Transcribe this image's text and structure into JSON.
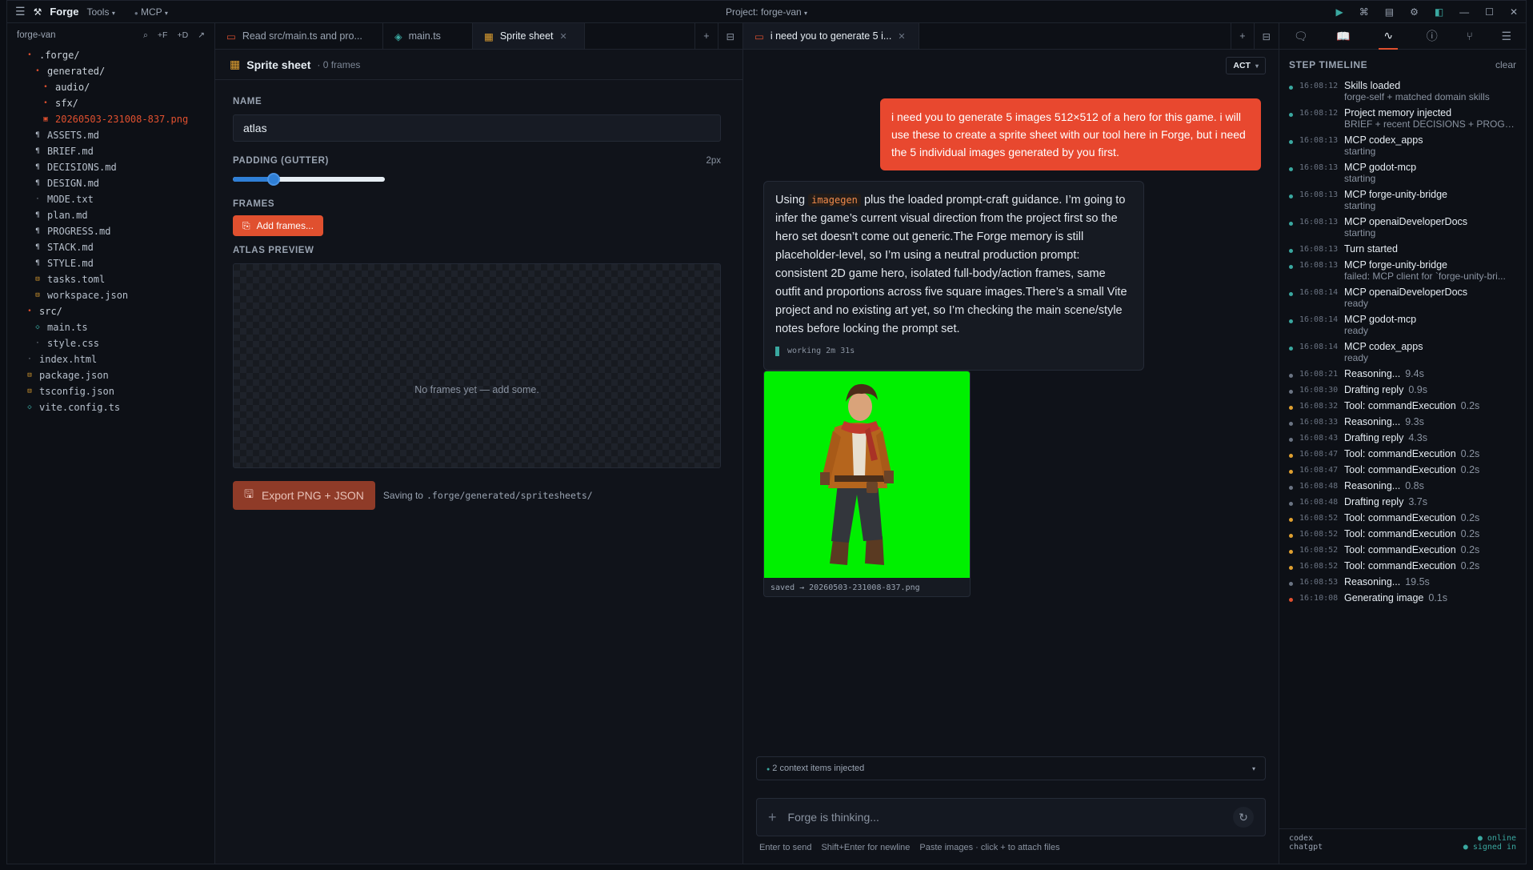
{
  "titlebar": {
    "brand": "Forge",
    "tools_label": "Tools",
    "mcp_label": "MCP",
    "project": "Project: forge-van"
  },
  "tree": {
    "root": "forge-van",
    "actions": [
      "+F",
      "+D"
    ],
    "items": [
      {
        "label": ".forge/",
        "icon": "chevron-icon",
        "indent": 1,
        "color": "#c9d1d9"
      },
      {
        "label": "generated/",
        "icon": "chevron-icon",
        "indent": 2,
        "color": "#c9d1d9"
      },
      {
        "label": "audio/",
        "icon": "chevron-icon",
        "indent": 3,
        "color": "#c9d1d9"
      },
      {
        "label": "sfx/",
        "icon": "chevron-icon",
        "indent": 3,
        "color": "#c9d1d9"
      },
      {
        "label": "20260503-231008-837.png",
        "icon": "image-file-icon",
        "indent": 3,
        "color": "#e0502f"
      },
      {
        "label": "ASSETS.md",
        "icon": "markdown-icon",
        "indent": 2,
        "color": "#b7c0cc"
      },
      {
        "label": "BRIEF.md",
        "icon": "markdown-icon",
        "indent": 2,
        "color": "#b7c0cc"
      },
      {
        "label": "DECISIONS.md",
        "icon": "markdown-icon",
        "indent": 2,
        "color": "#b7c0cc"
      },
      {
        "label": "DESIGN.md",
        "icon": "markdown-icon",
        "indent": 2,
        "color": "#b7c0cc"
      },
      {
        "label": "MODE.txt",
        "icon": "text-file-icon",
        "indent": 2,
        "color": "#b7c0cc"
      },
      {
        "label": "plan.md",
        "icon": "markdown-icon",
        "indent": 2,
        "color": "#b7c0cc"
      },
      {
        "label": "PROGRESS.md",
        "icon": "markdown-icon",
        "indent": 2,
        "color": "#b7c0cc"
      },
      {
        "label": "STACK.md",
        "icon": "markdown-icon",
        "indent": 2,
        "color": "#b7c0cc"
      },
      {
        "label": "STYLE.md",
        "icon": "markdown-icon",
        "indent": 2,
        "color": "#b7c0cc"
      },
      {
        "label": "tasks.toml",
        "icon": "config-file-icon",
        "indent": 2,
        "color": "#b7c0cc"
      },
      {
        "label": "workspace.json",
        "icon": "json-file-icon",
        "indent": 2,
        "color": "#b7c0cc"
      },
      {
        "label": "src/",
        "icon": "chevron-icon",
        "indent": 1,
        "color": "#c9d1d9"
      },
      {
        "label": "main.ts",
        "icon": "ts-file-icon",
        "indent": 2,
        "color": "#b7c0cc"
      },
      {
        "label": "style.css",
        "icon": "css-file-icon",
        "indent": 2,
        "color": "#b7c0cc"
      },
      {
        "label": "index.html",
        "icon": "html-file-icon",
        "indent": 1,
        "color": "#b7c0cc"
      },
      {
        "label": "package.json",
        "icon": "json-file-icon",
        "indent": 1,
        "color": "#b7c0cc"
      },
      {
        "label": "tsconfig.json",
        "icon": "json-file-icon",
        "indent": 1,
        "color": "#b7c0cc"
      },
      {
        "label": "vite.config.ts",
        "icon": "ts-file-icon",
        "indent": 1,
        "color": "#b7c0cc"
      }
    ]
  },
  "mid": {
    "tabs": [
      {
        "label": "Read src/main.ts and pro...",
        "icon": "chat-icon",
        "active": false
      },
      {
        "label": "main.ts",
        "icon": "ts-file-icon",
        "active": false
      },
      {
        "label": "Sprite sheet",
        "icon": "grid-icon",
        "active": true
      }
    ],
    "header_title": "Sprite sheet",
    "header_sub": "· 0 frames",
    "name_label": "NAME",
    "name_value": "atlas",
    "padding_label": "PADDING (GUTTER)",
    "padding_value_text": "2px",
    "padding_fraction": 0.27,
    "frames_label": "FRAMES",
    "add_frames": "Add frames...",
    "preview_label": "ATLAS PREVIEW",
    "preview_empty": "No frames yet — add some.",
    "export_label": "Export PNG + JSON",
    "saving_prefix": "Saving to",
    "saving_path": ".forge/generated/spritesheets/"
  },
  "chat": {
    "tab_label": "i need you to generate 5 i...",
    "mode": "ACT",
    "user_message": "i need you to generate 5 images 512×512 of a hero for this game. i will use these to create a sprite sheet with our tool here in Forge, but i need the 5 individual images generated by you first.",
    "ai_prefix": "Using",
    "ai_code": "imagegen",
    "ai_text": "plus the loaded prompt-craft guidance. I’m going to infer the game’s current visual direction from the project first so the hero set doesn’t come out generic.The Forge memory is still placeholder-level, so I’m using a neutral production prompt: consistent 2D game hero, isolated full-body/action frames, same outfit and proportions across five square images.There’s a small Vite project and no existing art yet, so I’m checking the main scene/style notes before locking the prompt set.",
    "working": "working 2m 31s",
    "image_caption": "saved → 20260503-231008-837.png",
    "context": "2 context items injected",
    "composer_placeholder": "Forge is thinking...",
    "hint_send": "Enter to send",
    "hint_newline": "Shift+Enter for newline",
    "hint_paste": "Paste images · click + to attach files"
  },
  "timeline": {
    "title": "STEP TIMELINE",
    "clear": "clear",
    "steps": [
      {
        "time": "16:08:12",
        "name": "Skills loaded",
        "sub": "forge-self + matched domain skills",
        "dur": "",
        "color": "#3aa8a0"
      },
      {
        "time": "16:08:12",
        "name": "Project memory injected",
        "sub": "BRIEF + recent DECISIONS + PROGR...",
        "dur": "",
        "color": "#3aa8a0"
      },
      {
        "time": "16:08:13",
        "name": "MCP codex_apps",
        "sub": "starting",
        "dur": "",
        "color": "#3aa8a0"
      },
      {
        "time": "16:08:13",
        "name": "MCP godot-mcp",
        "sub": "starting",
        "dur": "",
        "color": "#3aa8a0"
      },
      {
        "time": "16:08:13",
        "name": "MCP forge-unity-bridge",
        "sub": "starting",
        "dur": "",
        "color": "#3aa8a0"
      },
      {
        "time": "16:08:13",
        "name": "MCP openaiDeveloperDocs",
        "sub": "starting",
        "dur": "",
        "color": "#3aa8a0"
      },
      {
        "time": "16:08:13",
        "name": "Turn started",
        "sub": "",
        "dur": "",
        "color": "#3aa8a0"
      },
      {
        "time": "16:08:13",
        "name": "MCP forge-unity-bridge",
        "sub": "failed: MCP client for `forge-unity-bri...",
        "dur": "",
        "color": "#3aa8a0"
      },
      {
        "time": "16:08:14",
        "name": "MCP openaiDeveloperDocs",
        "sub": "ready",
        "dur": "",
        "color": "#3aa8a0"
      },
      {
        "time": "16:08:14",
        "name": "MCP godot-mcp",
        "sub": "ready",
        "dur": "",
        "color": "#3aa8a0"
      },
      {
        "time": "16:08:14",
        "name": "MCP codex_apps",
        "sub": "ready",
        "dur": "",
        "color": "#3aa8a0"
      },
      {
        "time": "16:08:21",
        "name": "Reasoning...",
        "sub": "",
        "dur": "9.4s",
        "color": "#6b7483"
      },
      {
        "time": "16:08:30",
        "name": "Drafting reply",
        "sub": "",
        "dur": "0.9s",
        "color": "#6b7483"
      },
      {
        "time": "16:08:32",
        "name": "Tool: commandExecution",
        "sub": "",
        "dur": "0.2s",
        "color": "#e0a030"
      },
      {
        "time": "16:08:33",
        "name": "Reasoning...",
        "sub": "",
        "dur": "9.3s",
        "color": "#6b7483"
      },
      {
        "time": "16:08:43",
        "name": "Drafting reply",
        "sub": "",
        "dur": "4.3s",
        "color": "#6b7483"
      },
      {
        "time": "16:08:47",
        "name": "Tool: commandExecution",
        "sub": "",
        "dur": "0.2s",
        "color": "#e0a030"
      },
      {
        "time": "16:08:47",
        "name": "Tool: commandExecution",
        "sub": "",
        "dur": "0.2s",
        "color": "#e0a030"
      },
      {
        "time": "16:08:48",
        "name": "Reasoning...",
        "sub": "",
        "dur": "0.8s",
        "color": "#6b7483"
      },
      {
        "time": "16:08:48",
        "name": "Drafting reply",
        "sub": "",
        "dur": "3.7s",
        "color": "#6b7483"
      },
      {
        "time": "16:08:52",
        "name": "Tool: commandExecution",
        "sub": "",
        "dur": "0.2s",
        "color": "#e0a030"
      },
      {
        "time": "16:08:52",
        "name": "Tool: commandExecution",
        "sub": "",
        "dur": "0.2s",
        "color": "#e0a030"
      },
      {
        "time": "16:08:52",
        "name": "Tool: commandExecution",
        "sub": "",
        "dur": "0.2s",
        "color": "#e0a030"
      },
      {
        "time": "16:08:52",
        "name": "Tool: commandExecution",
        "sub": "",
        "dur": "0.2s",
        "color": "#e0a030"
      },
      {
        "time": "16:08:53",
        "name": "Reasoning...",
        "sub": "",
        "dur": "19.5s",
        "color": "#6b7483"
      },
      {
        "time": "16:10:08",
        "name": "Generating image",
        "sub": "",
        "dur": "0.1s",
        "color": "#e0502f"
      }
    ],
    "foot_left_1": "codex",
    "foot_left_2": "chatgpt",
    "foot_right_1": "online",
    "foot_right_2": "signed in"
  }
}
